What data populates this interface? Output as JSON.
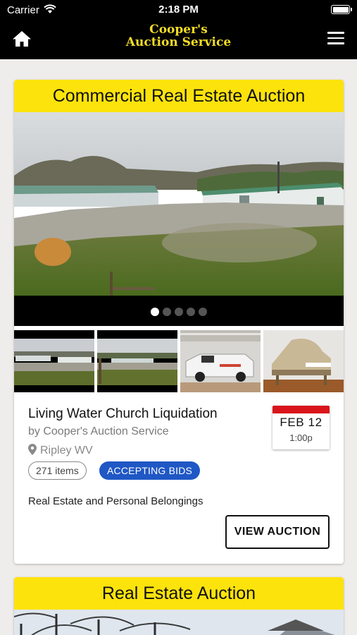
{
  "status_bar": {
    "carrier": "Carrier",
    "time": "2:18 PM"
  },
  "header": {
    "logo_line1": "Cooper's",
    "logo_line2": "Auction Service"
  },
  "auctions": [
    {
      "category": "Commercial Real Estate Auction",
      "title": "Living Water Church Liquidation",
      "byline": "by Cooper's Auction Service",
      "location": "Ripley WV",
      "items": "271 items",
      "status": "ACCEPTING BIDS",
      "description": "Real Estate and Personal Belongings",
      "date": "FEB 12",
      "time": "1:00p",
      "button": "VIEW AUCTION",
      "carousel_dots": 5,
      "active_dot": 1
    },
    {
      "category": "Real Estate Auction"
    }
  ],
  "colors": {
    "header_bg": "#000000",
    "logo": "#f2dc27",
    "banner": "#fde30c",
    "badge_blue": "#1f57c5",
    "date_red": "#d9151b"
  }
}
